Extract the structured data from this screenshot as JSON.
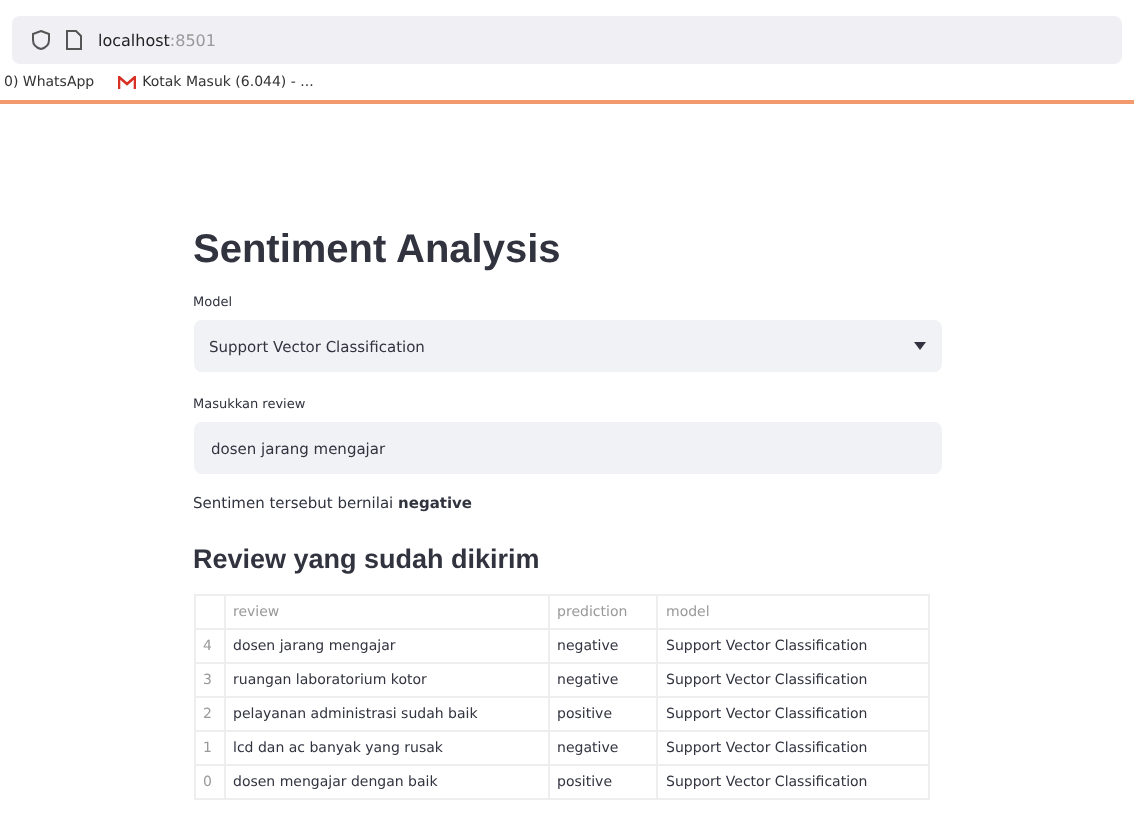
{
  "browser": {
    "url_host": "localhost",
    "url_port": ":8501",
    "bookmarks": [
      {
        "label": "0) WhatsApp",
        "kind": "plain"
      },
      {
        "label": "Kotak Masuk (6.044) - ...",
        "kind": "mail"
      }
    ]
  },
  "title": "Sentiment Analysis",
  "model_select": {
    "label": "Model",
    "value": "Support Vector Classification"
  },
  "review_input": {
    "label": "Masukkan review",
    "value": "dosen jarang mengajar"
  },
  "result": "Sentimen tersebut bernilai **negative**",
  "table": {
    "title": "Review yang sudah dikirim",
    "columns": [
      "review",
      "prediction",
      "model"
    ],
    "rows": [
      {
        "index": "4",
        "cells": [
          "dosen jarang mengajar",
          "negative",
          "Support Vector Classification"
        ]
      },
      {
        "index": "3",
        "cells": [
          "ruangan laboratorium kotor",
          "negative",
          "Support Vector Classification"
        ]
      },
      {
        "index": "2",
        "cells": [
          "pelayanan administrasi sudah baik",
          "positive",
          "Support Vector Classification"
        ]
      },
      {
        "index": "1",
        "cells": [
          "lcd dan ac banyak yang rusak",
          "negative",
          "Support Vector Classification"
        ]
      },
      {
        "index": "0",
        "cells": [
          "dosen mengajar dengan baik",
          "positive",
          "Support Vector Classification"
        ]
      }
    ]
  }
}
